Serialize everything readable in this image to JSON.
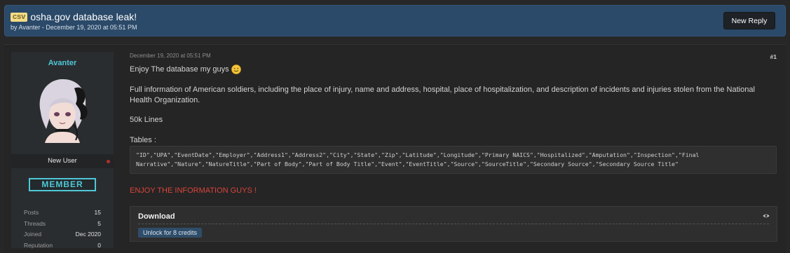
{
  "header": {
    "prefix": "csv",
    "title": "osha.gov database leak!",
    "byline": "by Avanter - December 19, 2020 at 05:51 PM",
    "new_reply_label": "New Reply"
  },
  "user": {
    "username": "Avanter",
    "rank": "New User",
    "badge": "MEMBER",
    "stats": [
      {
        "label": "Posts",
        "value": "15"
      },
      {
        "label": "Threads",
        "value": "5"
      },
      {
        "label": "Joined",
        "value": "Dec 2020"
      },
      {
        "label": "Reputation",
        "value": "0"
      }
    ]
  },
  "post": {
    "date": "December 19, 2020 at 05:51 PM",
    "number": "#1",
    "line1": "Enjoy The database my guys",
    "line2": "Full information of American soldiers, including the place of injury, name and address, hospital, place of hospitalization, and description of incidents and injuries stolen from the National Health Organization.",
    "line3": "50k Lines",
    "line4": "Tables :",
    "code": "\"ID\",\"UPA\",\"EventDate\",\"Employer\",\"Address1\",\"Address2\",\"City\",\"State\",\"Zip\",\"Latitude\",\"Longitude\",\"Primary NAICS\",\"Hospitalized\",\"Amputation\",\"Inspection\",\"Final Narrative\",\"Nature\",\"NatureTitle\",\"Part of Body\",\"Part of Body Title\",\"Event\",\"EventTitle\",\"Source\",\"SourceTitle\",\"Secondary Source\",\"Secondary Source Title\"",
    "enjoy": "ENJOY THE INFORMATION GUYS !"
  },
  "download": {
    "title": "Download",
    "unlock_label": "Unlock for 8 credits"
  },
  "colors": {
    "header_bg": "#2b4968",
    "accent_cyan": "#4fc8d8",
    "enjoy_red": "#d8443c",
    "unlock_bg": "#2f4d69"
  },
  "icons": {
    "emoji": "smile-icon",
    "reveal": "eye-icon"
  }
}
